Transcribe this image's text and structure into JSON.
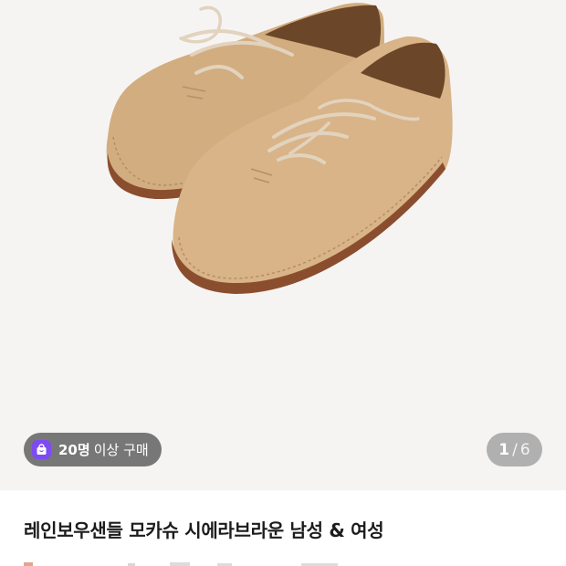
{
  "badge": {
    "icon": "shopping-bag-icon",
    "count": "20명",
    "text": "이상 구매"
  },
  "counter": {
    "current": "1",
    "separator": "/",
    "total": "6"
  },
  "product": {
    "title": "레인보우샌들 모카슈 시에라브라운 남성 & 여성"
  },
  "colors": {
    "accent": "#7d4bf2",
    "suede": "#d9b488",
    "sole": "#8a4e2e",
    "hero_bg": "#f6f4f3"
  }
}
